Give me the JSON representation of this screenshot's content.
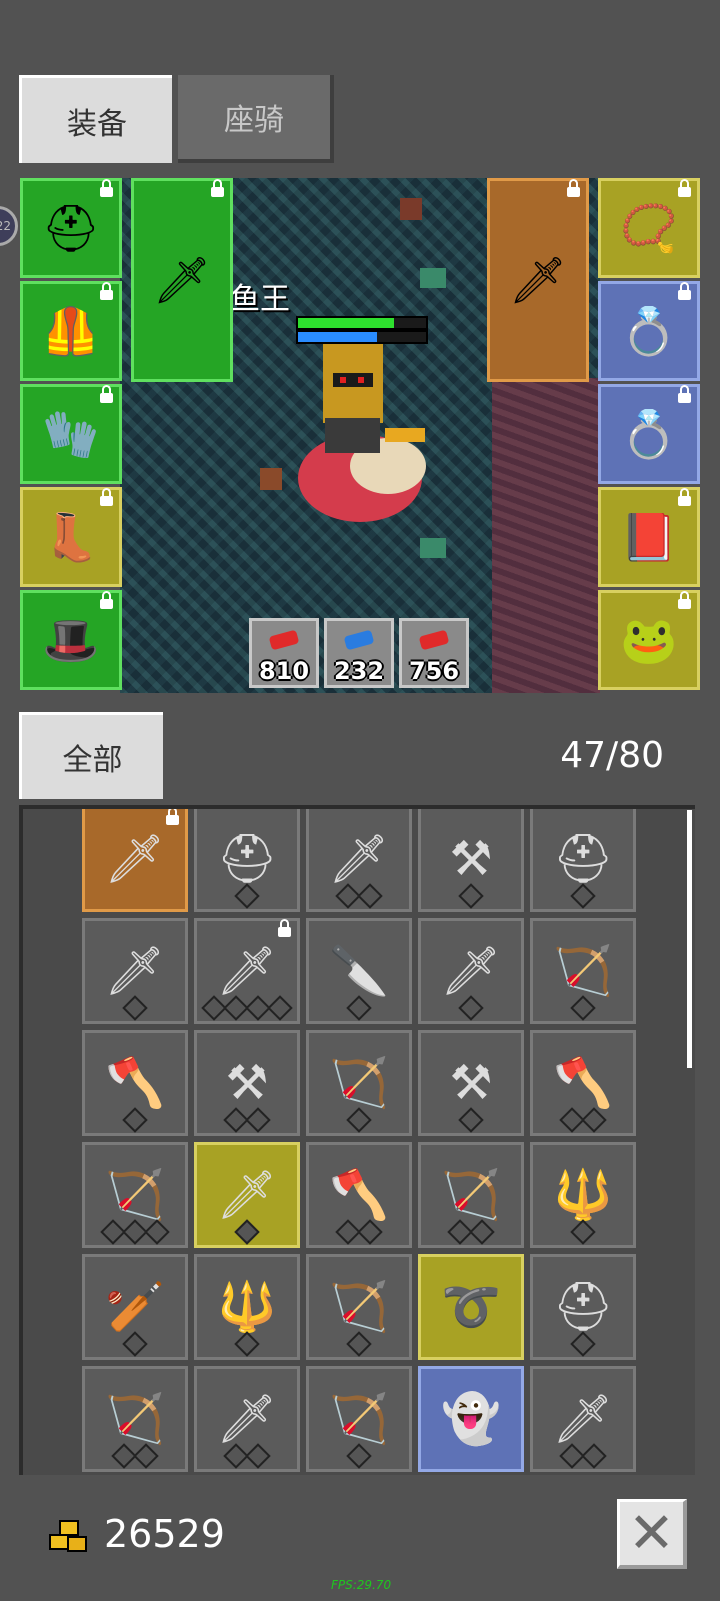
{
  "tabs": [
    {
      "label": "装备",
      "active": true
    },
    {
      "label": "座骑",
      "active": false
    }
  ],
  "side_bubble": {
    "text": "22"
  },
  "hero": {
    "name": "鱼王",
    "hp_fraction": 0.75,
    "mp_fraction": 0.62,
    "hp_color": "#2ee02e",
    "mp_color": "#2a8cff"
  },
  "equipment": {
    "left_slots": [
      {
        "icon": "golden-helmet-icon",
        "glyph": "⛑",
        "color": "green",
        "locked": true
      },
      {
        "icon": "leather-armor-icon",
        "glyph": "🦺",
        "color": "green",
        "locked": true
      },
      {
        "icon": "dark-gauntlet-icon",
        "glyph": "🧤",
        "color": "green",
        "locked": true
      },
      {
        "icon": "leather-boots-icon",
        "glyph": "👢",
        "color": "olive",
        "locked": true
      },
      {
        "icon": "dark-helmet-icon",
        "glyph": "🎩",
        "color": "green",
        "locked": true
      }
    ],
    "weapon_slot": {
      "icon": "purple-sword-icon",
      "glyph": "🗡",
      "color": "green",
      "locked": true
    },
    "offhand_slot": {
      "icon": "golden-sword-icon",
      "glyph": "🗡",
      "color": "orange",
      "locked": true
    },
    "right_slots": [
      {
        "icon": "horned-amulet-icon",
        "glyph": "📿",
        "color": "olive",
        "locked": true
      },
      {
        "icon": "gold-ring-icon",
        "glyph": "💍",
        "color": "blue",
        "locked": true
      },
      {
        "icon": "gold-ring-icon",
        "glyph": "💍",
        "color": "blue",
        "locked": true
      },
      {
        "icon": "spell-book-icon",
        "glyph": "📕",
        "color": "olive",
        "locked": true
      },
      {
        "icon": "pet-creature-icon",
        "glyph": "🐸",
        "color": "olive",
        "locked": true
      }
    ]
  },
  "stats": [
    {
      "value": "810",
      "icon": "red-gem-icon",
      "color": "#e02a2a"
    },
    {
      "value": "232",
      "icon": "blue-gem-icon",
      "color": "#2a7ce0"
    },
    {
      "value": "756",
      "icon": "red-gem-icon",
      "color": "#e02a2a"
    }
  ],
  "inventory": {
    "filter_label": "全部",
    "count": "47/80",
    "items": [
      {
        "icon": "red-sword-icon",
        "glyph": "🗡",
        "rarity": "orange",
        "locked": true,
        "stars": 0
      },
      {
        "icon": "horned-helmet-icon",
        "glyph": "⛑",
        "rarity": "common",
        "locked": false,
        "stars": 1
      },
      {
        "icon": "broadsword-icon",
        "glyph": "🗡",
        "rarity": "common",
        "locked": false,
        "stars": 2
      },
      {
        "icon": "mace-icon",
        "glyph": "⚒",
        "rarity": "common",
        "locked": false,
        "stars": 1
      },
      {
        "icon": "iron-helmet-icon",
        "glyph": "⛑",
        "rarity": "common",
        "locked": false,
        "stars": 1
      },
      {
        "icon": "long-sword-icon",
        "glyph": "🗡",
        "rarity": "common",
        "locked": false,
        "stars": 1
      },
      {
        "icon": "crystal-sword-icon",
        "glyph": "🗡",
        "rarity": "common",
        "locked": true,
        "stars": 4
      },
      {
        "icon": "dagger-icon",
        "glyph": "🔪",
        "rarity": "common",
        "locked": false,
        "stars": 1
      },
      {
        "icon": "long-sword-icon",
        "glyph": "🗡",
        "rarity": "common",
        "locked": false,
        "stars": 1
      },
      {
        "icon": "crossbow-icon",
        "glyph": "🏹",
        "rarity": "common",
        "locked": false,
        "stars": 1
      },
      {
        "icon": "axe-icon",
        "glyph": "🪓",
        "rarity": "common",
        "locked": false,
        "stars": 1
      },
      {
        "icon": "spiked-club-icon",
        "glyph": "⚒",
        "rarity": "common",
        "locked": false,
        "stars": 2
      },
      {
        "icon": "longbow-icon",
        "glyph": "🏹",
        "rarity": "common",
        "locked": false,
        "stars": 1
      },
      {
        "icon": "mace-icon",
        "glyph": "⚒",
        "rarity": "common",
        "locked": false,
        "stars": 1
      },
      {
        "icon": "battle-axe-icon",
        "glyph": "🪓",
        "rarity": "common",
        "locked": false,
        "stars": 2
      },
      {
        "icon": "crossbow-icon",
        "glyph": "🏹",
        "rarity": "common",
        "locked": false,
        "stars": 3
      },
      {
        "icon": "crystal-sword-icon",
        "glyph": "🗡",
        "rarity": "olive",
        "locked": false,
        "stars": 1
      },
      {
        "icon": "axe-icon",
        "glyph": "🪓",
        "rarity": "common",
        "locked": false,
        "stars": 2
      },
      {
        "icon": "recurve-bow-icon",
        "glyph": "🏹",
        "rarity": "common",
        "locked": false,
        "stars": 2
      },
      {
        "icon": "halberd-icon",
        "glyph": "🔱",
        "rarity": "common",
        "locked": false,
        "stars": 1
      },
      {
        "icon": "club-icon",
        "glyph": "🏏",
        "rarity": "common",
        "locked": false,
        "stars": 1
      },
      {
        "icon": "halberd-icon",
        "glyph": "🔱",
        "rarity": "common",
        "locked": false,
        "stars": 1
      },
      {
        "icon": "crossbow-icon",
        "glyph": "🏹",
        "rarity": "common",
        "locked": false,
        "stars": 1
      },
      {
        "icon": "belt-icon",
        "glyph": "➰",
        "rarity": "olive",
        "locked": false,
        "stars": 0
      },
      {
        "icon": "horned-helmet-icon",
        "glyph": "⛑",
        "rarity": "common",
        "locked": false,
        "stars": 1
      },
      {
        "icon": "recurve-bow-icon",
        "glyph": "🏹",
        "rarity": "common",
        "locked": false,
        "stars": 2
      },
      {
        "icon": "long-sword-icon",
        "glyph": "🗡",
        "rarity": "common",
        "locked": false,
        "stars": 2
      },
      {
        "icon": "crossbow-icon",
        "glyph": "🏹",
        "rarity": "common",
        "locked": false,
        "stars": 1
      },
      {
        "icon": "ghost-card-icon",
        "glyph": "👻",
        "rarity": "blue",
        "locked": false,
        "stars": 0
      },
      {
        "icon": "long-sword-icon",
        "glyph": "🗡",
        "rarity": "common",
        "locked": false,
        "stars": 2
      }
    ]
  },
  "gold": {
    "amount": "26529",
    "icon": "gold-coins-icon"
  },
  "close_button": {
    "icon": "close-icon",
    "glyph": "✕"
  },
  "fps": "FPS:29.70"
}
